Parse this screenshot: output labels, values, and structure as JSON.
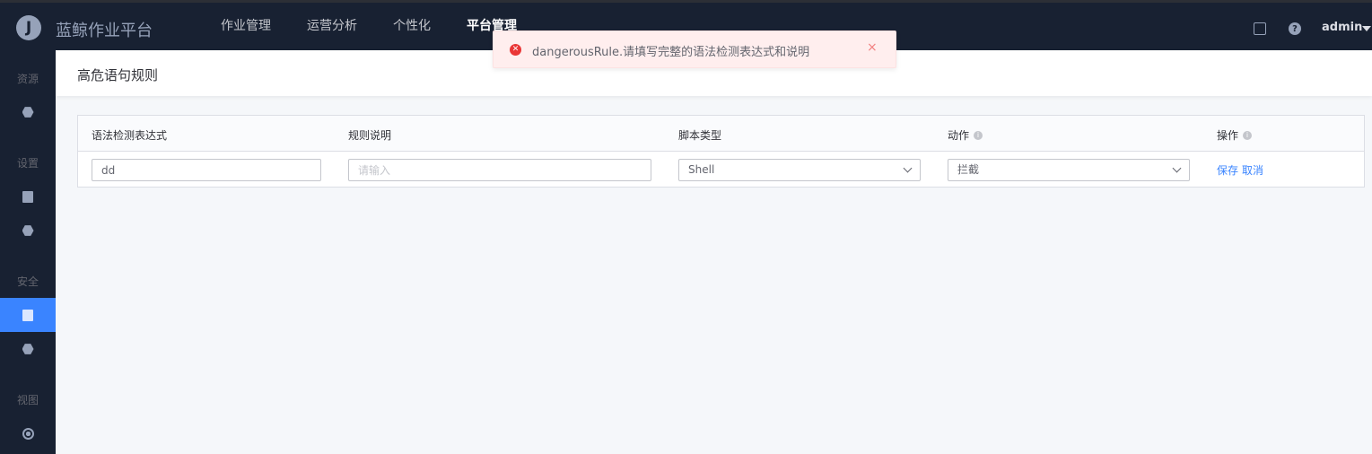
{
  "header": {
    "logo_letter": "J",
    "app_title": "蓝鲸作业平台",
    "nav": [
      {
        "label": "作业管理"
      },
      {
        "label": "运营分析"
      },
      {
        "label": "个性化"
      },
      {
        "label": "平台管理"
      }
    ],
    "active_nav": "平台管理",
    "help_glyph": "?",
    "user": "admin"
  },
  "sidebar": {
    "groups": [
      {
        "label": "资源"
      },
      {
        "label": "设置"
      },
      {
        "label": "安全"
      },
      {
        "label": "视图"
      }
    ]
  },
  "page": {
    "title": "高危语句规则"
  },
  "table": {
    "columns": [
      "语法检测表达式",
      "规则说明",
      "脚本类型",
      "动作",
      "操作"
    ],
    "row": {
      "expression_value": "dd",
      "description_placeholder": "请输入",
      "script_type": "Shell",
      "action": "拦截",
      "save_label": "保存",
      "cancel_label": "取消"
    }
  },
  "toast": {
    "message": "dangerousRule.请填写完整的语法检测表达式和说明",
    "close_glyph": "×"
  },
  "colors": {
    "header_bg": "#182132",
    "accent": "#3a84ff",
    "error": "#ea3636"
  }
}
